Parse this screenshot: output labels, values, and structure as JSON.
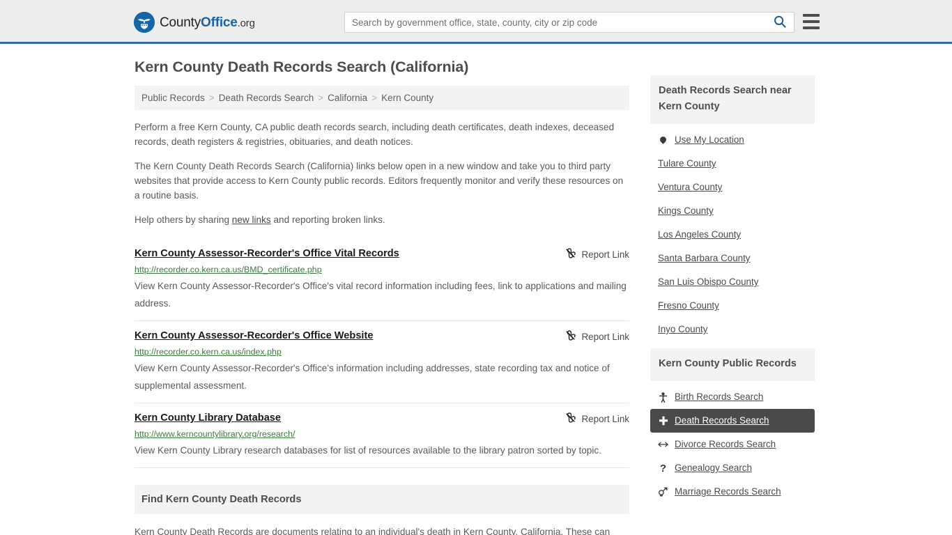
{
  "header": {
    "brand": {
      "part1": "County",
      "part2": "Office",
      "tld": ".org",
      "icon": "eagle-shield-logo"
    },
    "search": {
      "placeholder": "Search by government office, state, county, city or zip code",
      "value": "",
      "search_icon": "search-icon"
    },
    "menu_icon": "hamburger-menu-icon",
    "accent_color": "#2e6da4"
  },
  "main": {
    "title": "Kern County Death Records Search (California)",
    "breadcrumb": [
      "Public Records",
      "Death Records Search",
      "California",
      "Kern County"
    ],
    "breadcrumb_separator": ">",
    "intro": [
      "Perform a free Kern County, CA public death records search, including death certificates, death indexes, deceased records, death registers & registries, obituaries, and death notices.",
      "The Kern County Death Records Search (California) links below open in a new window and take you to third party websites that provide access to Kern County public records. Editors frequently monitor and verify these resources on a routine basis."
    ],
    "help_line": {
      "before": "Help others by sharing ",
      "link": "new links",
      "after": " and reporting broken links."
    },
    "report_label": "Report Link",
    "report_icon": "broken-link-icon",
    "results": [
      {
        "title": "Kern County Assessor-Recorder's Office Vital Records",
        "url": "http://recorder.co.kern.ca.us/BMD_certificate.php",
        "description": "View Kern County Assessor-Recorder's Office's vital record information including fees, link to applications and mailing address."
      },
      {
        "title": "Kern County Assessor-Recorder's Office Website",
        "url": "http://recorder.co.kern.ca.us/index.php",
        "description": "View Kern County Assessor-Recorder's Office's information including addresses, state recording tax and notice of supplemental assessment."
      },
      {
        "title": "Kern County Library Database",
        "url": "http://www.kerncountylibrary.org/research/",
        "description": "View Kern County Library research databases for list of resources available to the library patron sorted by topic."
      }
    ],
    "find_section": {
      "heading": "Find Kern County Death Records",
      "body": "Kern County Death Records are documents relating to an individual's death in Kern County, California. These can"
    }
  },
  "sidebar": {
    "nearby_panel": {
      "title": "Death Records Search near Kern County",
      "use_my_location": {
        "label": "Use My Location",
        "icon": "location-pin-icon"
      },
      "counties": [
        "Tulare County",
        "Ventura County",
        "Kings County",
        "Los Angeles County",
        "Santa Barbara County",
        "San Luis Obispo County",
        "Fresno County",
        "Inyo County"
      ]
    },
    "public_records_panel": {
      "title": "Kern County Public Records",
      "items": [
        {
          "label": "Birth Records Search",
          "icon": "baby-icon",
          "glyph": "Ɣ",
          "active": false
        },
        {
          "label": "Death Records Search",
          "icon": "cross-plus-icon",
          "glyph": "✚",
          "active": true
        },
        {
          "label": "Divorce Records Search",
          "icon": "left-right-arrow-icon",
          "glyph": "↔",
          "active": false
        },
        {
          "label": "Genealogy Search",
          "icon": "question-mark-icon",
          "glyph": "?",
          "active": false
        },
        {
          "label": "Marriage Records Search",
          "icon": "male-female-symbol-icon",
          "glyph": "⚥",
          "active": false
        }
      ],
      "active_bg": "#4a4a4a"
    }
  }
}
